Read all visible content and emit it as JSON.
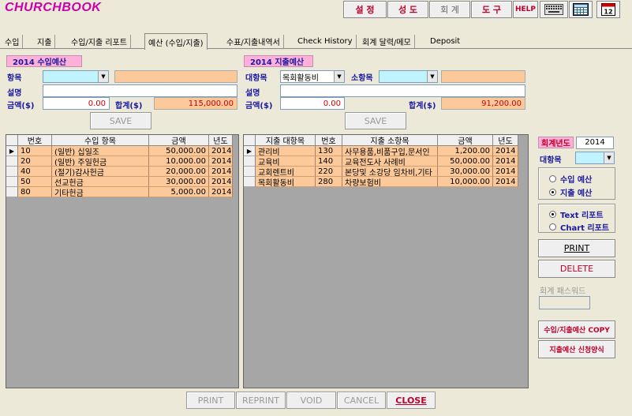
{
  "app": {
    "logo": "CHURCHBOOK"
  },
  "toolbar": {
    "settings": "설 정",
    "saints": "성 도",
    "accounting": "회 계",
    "tools": "도 구",
    "help": "HELP"
  },
  "tabs": [
    "수입",
    "지출",
    "수입/지출 리포트",
    "예산 (수입/지출)",
    "수표/지출내역서",
    "Check History",
    "회계 달력/메모",
    "Deposit"
  ],
  "income_panel": {
    "title": "2014 수입예산",
    "item_label": "항목",
    "item_value": "",
    "desc_label": "설명",
    "amount_label": "금액($)",
    "amount_value": "0.00",
    "total_label": "합계($)",
    "total_value": "115,000.00",
    "save_label": "SAVE"
  },
  "expense_panel": {
    "title": "2014 지출예산",
    "major_label": "대항목",
    "major_value": "목회활동비",
    "minor_label": "소항목",
    "minor_value": "",
    "desc_label": "설명",
    "amount_label": "금액($)",
    "amount_value": "0.00",
    "total_label": "합계($)",
    "total_value": "91,200.00",
    "save_label": "SAVE"
  },
  "income_grid": {
    "headers": [
      "번호",
      "수입 항목",
      "금액",
      "년도"
    ],
    "rows": [
      {
        "no": "10",
        "item": "(일반) 십일조",
        "amount": "50,000.00",
        "year": "2014"
      },
      {
        "no": "20",
        "item": "(일반) 주일헌금",
        "amount": "10,000.00",
        "year": "2014"
      },
      {
        "no": "40",
        "item": "(절기)감사헌금",
        "amount": "20,000.00",
        "year": "2014"
      },
      {
        "no": "50",
        "item": "선교헌금",
        "amount": "30,000.00",
        "year": "2014"
      },
      {
        "no": "80",
        "item": "기타헌금",
        "amount": "5,000.00",
        "year": "2014"
      }
    ]
  },
  "expense_grid": {
    "headers": [
      "지출 대항목",
      "번호",
      "지출 소항목",
      "금액",
      "년도"
    ],
    "rows": [
      {
        "major": "관리비",
        "no": "130",
        "minor": "사무용품,비품구입,문서인",
        "amount": "1,200.00",
        "year": "2014"
      },
      {
        "major": "교육비",
        "no": "140",
        "minor": "교육전도사 사례비",
        "amount": "50,000.00",
        "year": "2014"
      },
      {
        "major": "교회렌트비",
        "no": "220",
        "minor": "본당및 소강당 임차비,기타",
        "amount": "30,000.00",
        "year": "2014"
      },
      {
        "major": "목회활동비",
        "no": "280",
        "minor": "차량보험비",
        "amount": "10,000.00",
        "year": "2014"
      }
    ]
  },
  "side": {
    "fiscal_year_label": "회계년도",
    "fiscal_year_value": "2014",
    "major_label": "대항목",
    "major_value": "",
    "radio_income": "수입 예산",
    "radio_expense": "지출 예산",
    "radio_expense_selected": true,
    "radio_text_report": "Text 리포트",
    "radio_chart_report": "Chart 리포트",
    "radio_text_selected": true,
    "print_label": "PRINT",
    "delete_label": "DELETE",
    "password_label": "회계 패스워드",
    "copy_label": "수입/지출예산 COPY",
    "request_label": "지출예산 신청양식"
  },
  "bottom": {
    "print": "PRINT",
    "reprint": "REPRINT",
    "void": "VOID",
    "cancel": "CANCEL",
    "close": "CLOSE"
  },
  "colors": {
    "accent_red": "#c0002a",
    "label_blue": "#1a1aa0",
    "orange_field": "#fcc99b",
    "pink_title": "#ffb0d8",
    "cyan_field": "#bff3ff"
  }
}
